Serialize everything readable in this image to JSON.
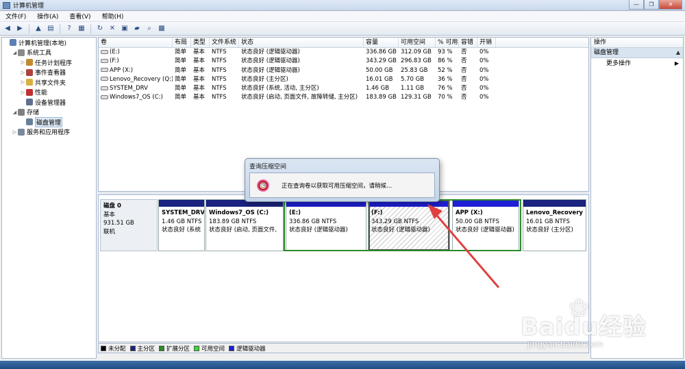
{
  "window": {
    "title": "计算机管理"
  },
  "menu": [
    "文件(F)",
    "操作(A)",
    "查看(V)",
    "帮助(H)"
  ],
  "toolbar_icons": [
    "back-icon",
    "forward-icon",
    "up-folder-icon",
    "show-hide-tree-icon",
    "help-icon",
    "properties-icon",
    "refresh-icon",
    "delete-icon",
    "export-icon",
    "open-icon",
    "find-icon",
    "settings-icon"
  ],
  "tree": [
    {
      "label": "计算机管理(本地)",
      "indent": 0,
      "expander": "",
      "icon": "#5b7fb5"
    },
    {
      "label": "系统工具",
      "indent": 1,
      "expander": "◢",
      "icon": "#8a8a8a"
    },
    {
      "label": "任务计划程序",
      "indent": 2,
      "expander": "▷",
      "icon": "#c08a30"
    },
    {
      "label": "事件查看器",
      "indent": 2,
      "expander": "▷",
      "icon": "#b04040"
    },
    {
      "label": "共享文件夹",
      "indent": 2,
      "expander": "▷",
      "icon": "#d8b040"
    },
    {
      "label": "性能",
      "indent": 2,
      "expander": "▷",
      "icon": "#c03030"
    },
    {
      "label": "设备管理器",
      "indent": 2,
      "expander": "",
      "icon": "#607090"
    },
    {
      "label": "存储",
      "indent": 1,
      "expander": "◢",
      "icon": "#808080"
    },
    {
      "label": "磁盘管理",
      "indent": 2,
      "expander": "",
      "icon": "#6a7f99",
      "selected": true
    },
    {
      "label": "服务和应用程序",
      "indent": 1,
      "expander": "▷",
      "icon": "#7a8a9a"
    }
  ],
  "volumes": {
    "headers": [
      "卷",
      "布局",
      "类型",
      "文件系统",
      "状态",
      "容量",
      "可用空间",
      "% 可用",
      "容错",
      "开销"
    ],
    "rows": [
      [
        "(E:)",
        "简单",
        "基本",
        "NTFS",
        "状态良好 (逻辑驱动器)",
        "336.86 GB",
        "312.09 GB",
        "93 %",
        "否",
        "0%"
      ],
      [
        "(F:)",
        "简单",
        "基本",
        "NTFS",
        "状态良好 (逻辑驱动器)",
        "343.29 GB",
        "296.83 GB",
        "86 %",
        "否",
        "0%"
      ],
      [
        "APP (X:)",
        "简单",
        "基本",
        "NTFS",
        "状态良好 (逻辑驱动器)",
        "50.00 GB",
        "25.83 GB",
        "52 %",
        "否",
        "0%"
      ],
      [
        "Lenovo_Recovery (Q:)",
        "简单",
        "基本",
        "NTFS",
        "状态良好 (主分区)",
        "16.01 GB",
        "5.70 GB",
        "36 %",
        "否",
        "0%"
      ],
      [
        "SYSTEM_DRV",
        "简单",
        "基本",
        "NTFS",
        "状态良好 (系统, 活动, 主分区)",
        "1.46 GB",
        "1.11 GB",
        "76 %",
        "否",
        "0%"
      ],
      [
        "Windows7_OS (C:)",
        "简单",
        "基本",
        "NTFS",
        "状态良好 (启动, 页面文件, 故障转储, 主分区)",
        "183.89 GB",
        "129.31 GB",
        "70 %",
        "否",
        "0%"
      ]
    ]
  },
  "disk": {
    "name": "磁盘 0",
    "type": "基本",
    "size": "931.51 GB",
    "status": "联机",
    "partitions": [
      {
        "name": "SYSTEM_DRV",
        "size": "1.46 GB NTFS",
        "status": "状态良好 (系统"
      },
      {
        "name": "Windows7_OS  (C:)",
        "size": "183.89 GB NTFS",
        "status": "状态良好 (启动, 页面文件,"
      },
      {
        "name": "(E:)",
        "size": "336.86 GB NTFS",
        "status": "状态良好 (逻辑驱动器)"
      },
      {
        "name": "(F:)",
        "size": "343.29 GB NTFS",
        "status": "状态良好 (逻辑驱动器)"
      },
      {
        "name": "APP  (X:)",
        "size": "50.00 GB NTFS",
        "status": "状态良好 (逻辑驱动器)"
      },
      {
        "name": "Lenovo_Recovery",
        "size": "16.01 GB NTFS",
        "status": "状态良好 (主分区)"
      }
    ]
  },
  "legend": [
    {
      "label": "未分配",
      "color": "#000000"
    },
    {
      "label": "主分区",
      "color": "#1a237e"
    },
    {
      "label": "扩展分区",
      "color": "#2a8a2a"
    },
    {
      "label": "可用空间",
      "color": "#33dd33"
    },
    {
      "label": "逻辑驱动器",
      "color": "#1f1fd6"
    }
  ],
  "actions": {
    "header": "操作",
    "section": "磁盘管理",
    "items": [
      "更多操作"
    ]
  },
  "dialog": {
    "title": "查询压缩空间",
    "message": "正在查询卷以获取可用压缩空间，请稍候..."
  },
  "watermark": {
    "logo": "Baidu经验",
    "url": "jingyan.baidu.com"
  },
  "colors": {
    "logical_drive": "#1f1fd6",
    "primary_partition": "#1a237e",
    "extended_partition": "#2a8a2a",
    "arrow": "#e04040"
  }
}
